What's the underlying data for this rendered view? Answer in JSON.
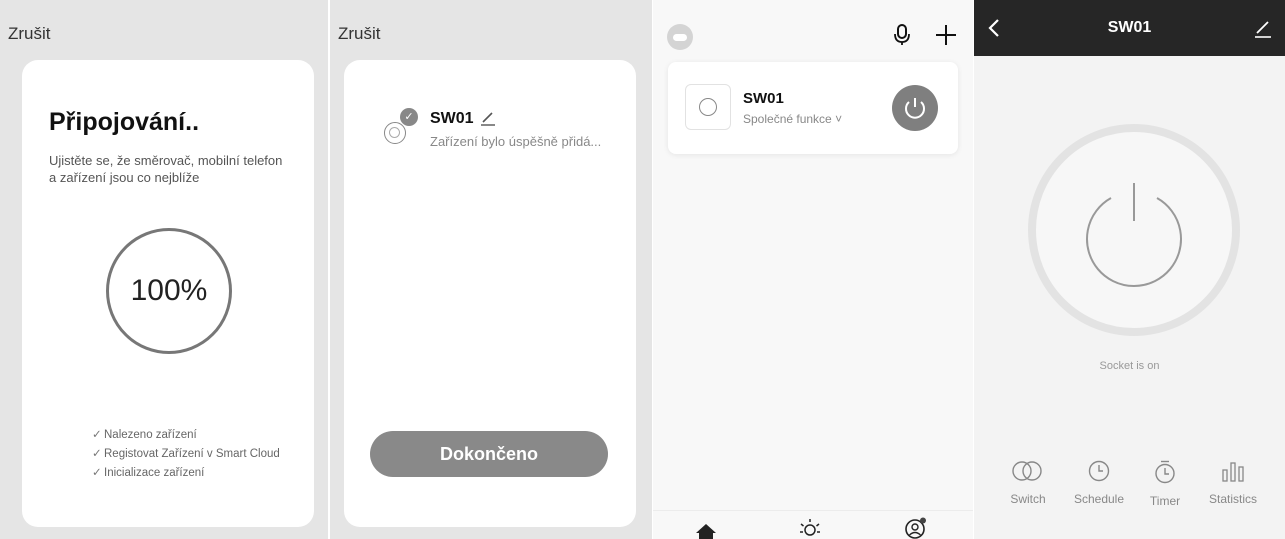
{
  "panel1": {
    "cancel_label": "Zrušit",
    "title": "Připojování..",
    "subtitle": "Ujistěte se, že směrovač, mobilní telefon a zařízení jsou co nejblíže",
    "progress_text": "100%",
    "progress_value": 100,
    "steps": [
      "Nalezeno zařízení",
      "Registovat Zařízení  v Smart Cloud",
      "Inicializace zařízení"
    ]
  },
  "panel2": {
    "cancel_label": "Zrušit",
    "device_name": "SW01",
    "device_desc": "Zařízení bylo úspěšně přidá...",
    "done_label": "Dokončeno"
  },
  "panel3": {
    "device_name": "SW01",
    "device_func": "Společné funkce ˅"
  },
  "panel4": {
    "title": "SW01",
    "status": "Socket is on",
    "tabs": [
      "Switch",
      "Schedule",
      "Timer",
      "Statistics"
    ]
  },
  "colors": {
    "button_gray": "#898989",
    "header_dark": "#262626",
    "panel_bg": "#e5e5e5"
  }
}
